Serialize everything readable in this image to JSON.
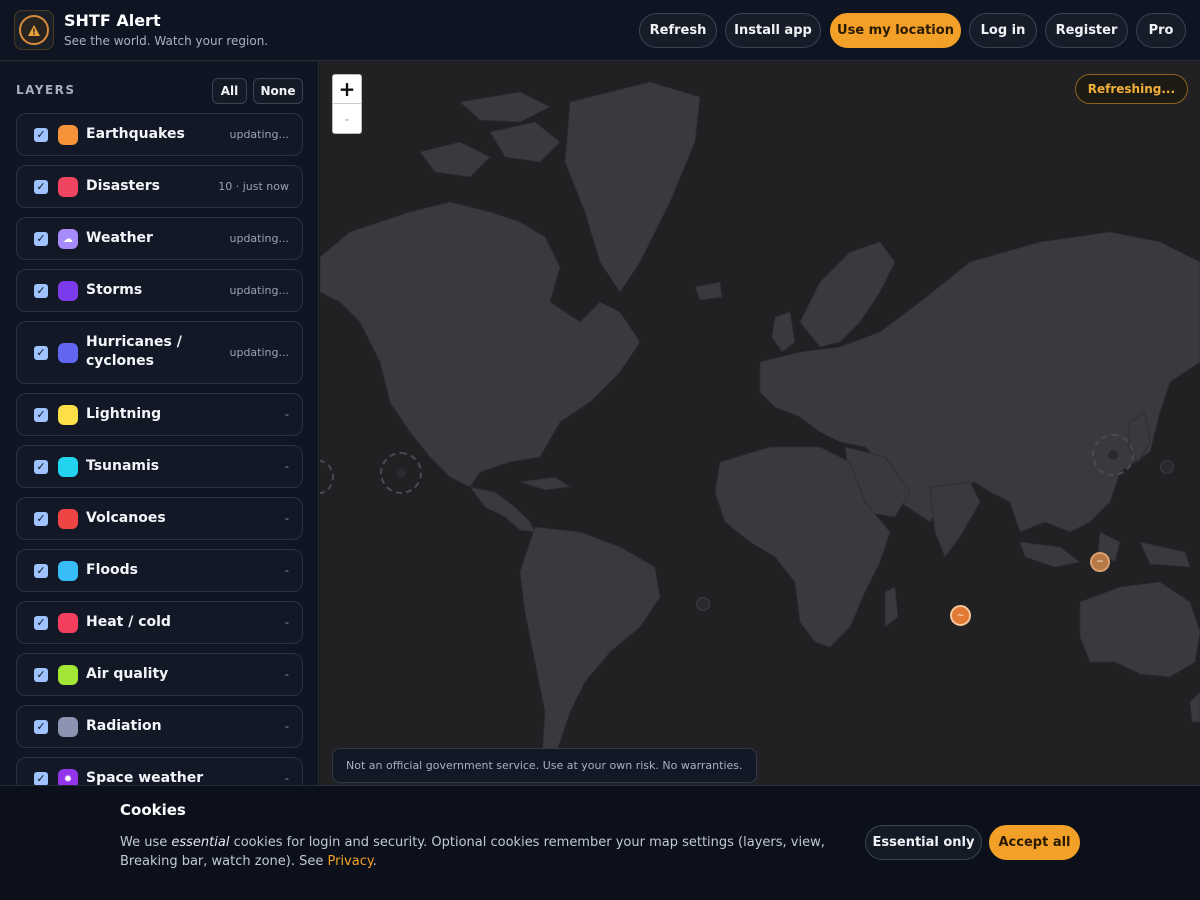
{
  "header": {
    "title": "SHTF Alert",
    "subtitle": "See the world. Watch your region.",
    "buttons": {
      "refresh": "Refresh",
      "install": "Install app",
      "location": "Use my location",
      "login": "Log in",
      "register": "Register",
      "pro": "Pro"
    }
  },
  "sidebar": {
    "title": "LAYERS",
    "all_label": "All",
    "none_label": "None",
    "layers": [
      {
        "name": "Earthquakes",
        "status": "updating...",
        "color": "#f5923a",
        "checked": true
      },
      {
        "name": "Disasters",
        "status": "10 · just now",
        "color": "#ef4560",
        "checked": true
      },
      {
        "name": "Weather",
        "status": "updating...",
        "color": "#a78bfa",
        "checked": true
      },
      {
        "name": "Storms",
        "status": "updating...",
        "color": "#7c3aed",
        "checked": true
      },
      {
        "name": "Hurricanes / cyclones",
        "status": "updating...",
        "color": "#6366f1",
        "checked": true
      },
      {
        "name": "Lightning",
        "status": "-",
        "color": "#fde047",
        "checked": true
      },
      {
        "name": "Tsunamis",
        "status": "-",
        "color": "#22d3ee",
        "checked": true
      },
      {
        "name": "Volcanoes",
        "status": "-",
        "color": "#ef4444",
        "checked": true
      },
      {
        "name": "Floods",
        "status": "-",
        "color": "#38bdf8",
        "checked": true
      },
      {
        "name": "Heat / cold",
        "status": "-",
        "color": "#f43f5e",
        "checked": true
      },
      {
        "name": "Air quality",
        "status": "-",
        "color": "#a3e635",
        "checked": true
      },
      {
        "name": "Radiation",
        "status": "-",
        "color": "#8b93b0",
        "checked": true
      },
      {
        "name": "Space weather",
        "status": "-",
        "color": "#9333ea",
        "checked": true
      }
    ]
  },
  "map": {
    "zoom_in": "+",
    "zoom_out": "-",
    "refreshing": "Refreshing...",
    "disclaimer": "Not an official government service. Use at your own risk. No warranties."
  },
  "cookie": {
    "title": "Cookies",
    "text_prefix": "We use ",
    "text_em": "essential",
    "text_mid": " cookies for login and security. Optional cookies remember your map settings (layers, view, Breaking bar, watch zone). See ",
    "privacy_link": "Privacy",
    "text_suffix": ".",
    "essential_label": "Essential only",
    "accept_label": "Accept all"
  }
}
